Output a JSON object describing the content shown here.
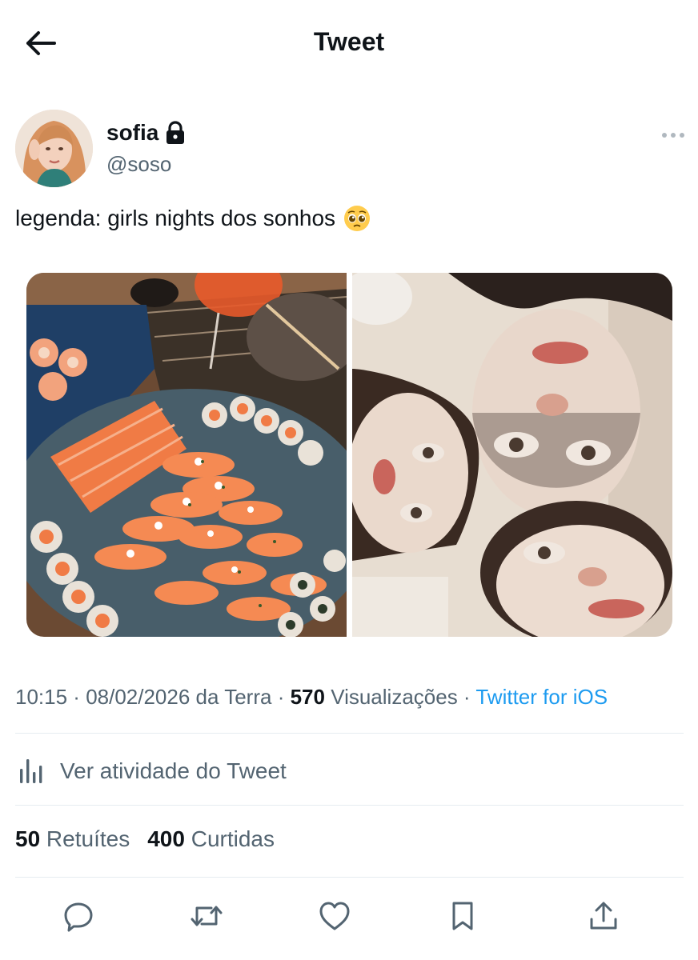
{
  "header": {
    "title": "Tweet",
    "back_icon": "arrow-left-icon"
  },
  "author": {
    "name": "sofia",
    "handle": "@soso",
    "protected_icon": "lock-icon"
  },
  "tweet": {
    "text": "legenda: girls nights dos sonhos",
    "emoji_icon": "pleading-face-icon",
    "media_count": 2
  },
  "meta": {
    "time": "10:15",
    "sep1": " · ",
    "date": "08/02/2026",
    "location": " da Terra",
    "sep2": " · ",
    "views_count": "570",
    "views_label": " Visualizações",
    "sep3": " · ",
    "client": "Twitter for iOS"
  },
  "activity": {
    "label": "Ver atividade do Tweet",
    "icon": "analytics-icon"
  },
  "stats": {
    "retweets_count": "50",
    "retweets_label": " Retuítes",
    "likes_count": "400",
    "likes_label": " Curtidas"
  },
  "actions": [
    "reply-icon",
    "retweet-icon",
    "like-icon",
    "bookmark-icon",
    "share-icon"
  ],
  "colors": {
    "link": "#1d9bf0",
    "text": "#0f1419",
    "secondary": "#536471",
    "divider": "#e6ecf0"
  }
}
